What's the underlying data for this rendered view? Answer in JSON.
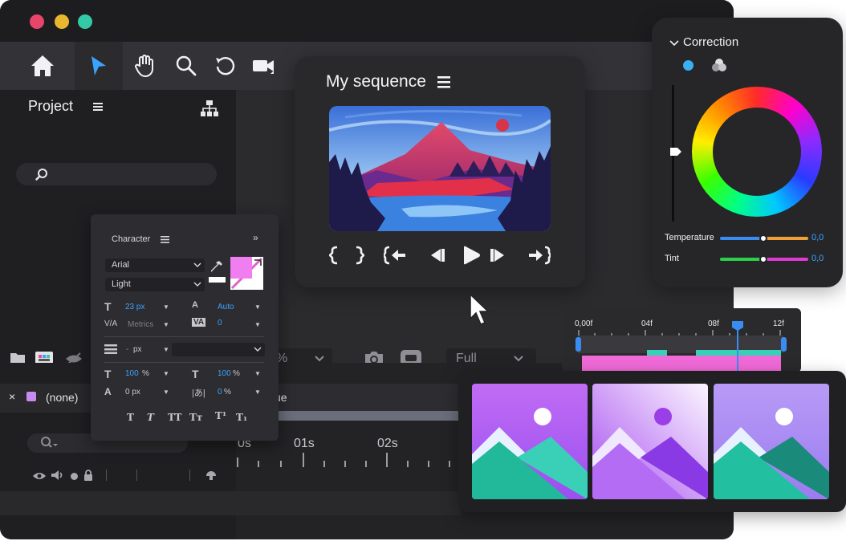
{
  "window": {
    "traffic_lights": [
      "#e8456b",
      "#e8b72f",
      "#34c9a4"
    ]
  },
  "toolbar": {
    "tools": [
      "home-icon",
      "pointer-icon",
      "hand-icon",
      "zoom-icon",
      "undo-icon",
      "camera-icon"
    ]
  },
  "project": {
    "title": "Project",
    "search_placeholder": ""
  },
  "sequence": {
    "title": "My sequence",
    "menu_icon": "menu-icon"
  },
  "correction": {
    "title": "Correction",
    "temperature": {
      "label": "Temperature",
      "value": "0,0"
    },
    "tint": {
      "label": "Tint",
      "value": "0,0"
    }
  },
  "character": {
    "title": "Character",
    "font_family": "Arial",
    "font_style": "Light",
    "font_size": "23 px",
    "leading": "Auto",
    "kerning": "Metrics",
    "tracking": "0",
    "stroke_width": "-",
    "stroke_unit": "px",
    "vertical_scale": "100",
    "vertical_scale_unit": "%",
    "horizontal_scale": "100",
    "horizontal_scale_unit": "%",
    "baseline_shift": "0 px",
    "tsume": "0",
    "tsume_unit": "%",
    "fill_color": "#f07ef0",
    "style_buttons": [
      "T",
      "T",
      "TT",
      "Tт",
      "T¹",
      "T₁"
    ]
  },
  "program": {
    "zoom_value": "%",
    "quality_value": "Full"
  },
  "timeline_mini": {
    "ticks": [
      "0,00f",
      "04f",
      "08f",
      "12f"
    ]
  },
  "track": {
    "name": "(none)",
    "close": "×",
    "clip_label": "ue",
    "ruler": [
      "0s",
      "01s",
      "02s"
    ]
  },
  "thumbnails": [
    {
      "bg_top": "#c06cf4",
      "bg_bottom": "#9a4ff0"
    },
    {
      "bg_top": "#f6f0ff",
      "bg_bottom": "#a64cf0"
    },
    {
      "bg_top": "#b89af6",
      "bg_bottom": "#9a7cf0"
    }
  ]
}
